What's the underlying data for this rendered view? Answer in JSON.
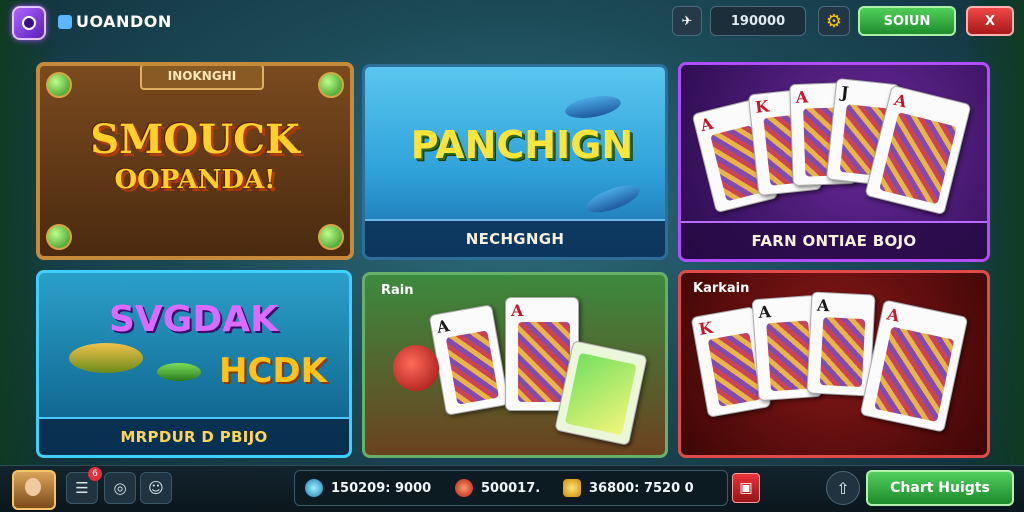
{
  "header": {
    "brand": "UOANDON",
    "coins": "190000",
    "signin_label": "SOIUN",
    "close_label": "X"
  },
  "tiles": [
    {
      "plate": "INOKNGHI",
      "title_line1": "SMOUCK",
      "title_line2": "OOPANDA!"
    },
    {
      "title": "PANCHIGN",
      "caption": "NECHGNGH"
    },
    {
      "caption": "FARN ONTIAE BOJO"
    },
    {
      "title_line1": "SVGDAK",
      "title_line2": "HCDK",
      "caption": "MRPDUR D PBIJO"
    },
    {
      "corner_label": "Rain"
    },
    {
      "corner_label": "Karkain"
    }
  ],
  "footer": {
    "notification_count": "6",
    "balance_gems": "150209: 9000",
    "balance_ruby": "500017.",
    "balance_gold": "36800:  7520 0",
    "chat_label": "Chart Huigts"
  },
  "colors": {
    "signin_green": "#1f8e2c",
    "close_red": "#a81717",
    "tile3_border": "#b14cff",
    "tile4_border": "#3fd0ff",
    "tile6_border": "#e04a4a"
  }
}
